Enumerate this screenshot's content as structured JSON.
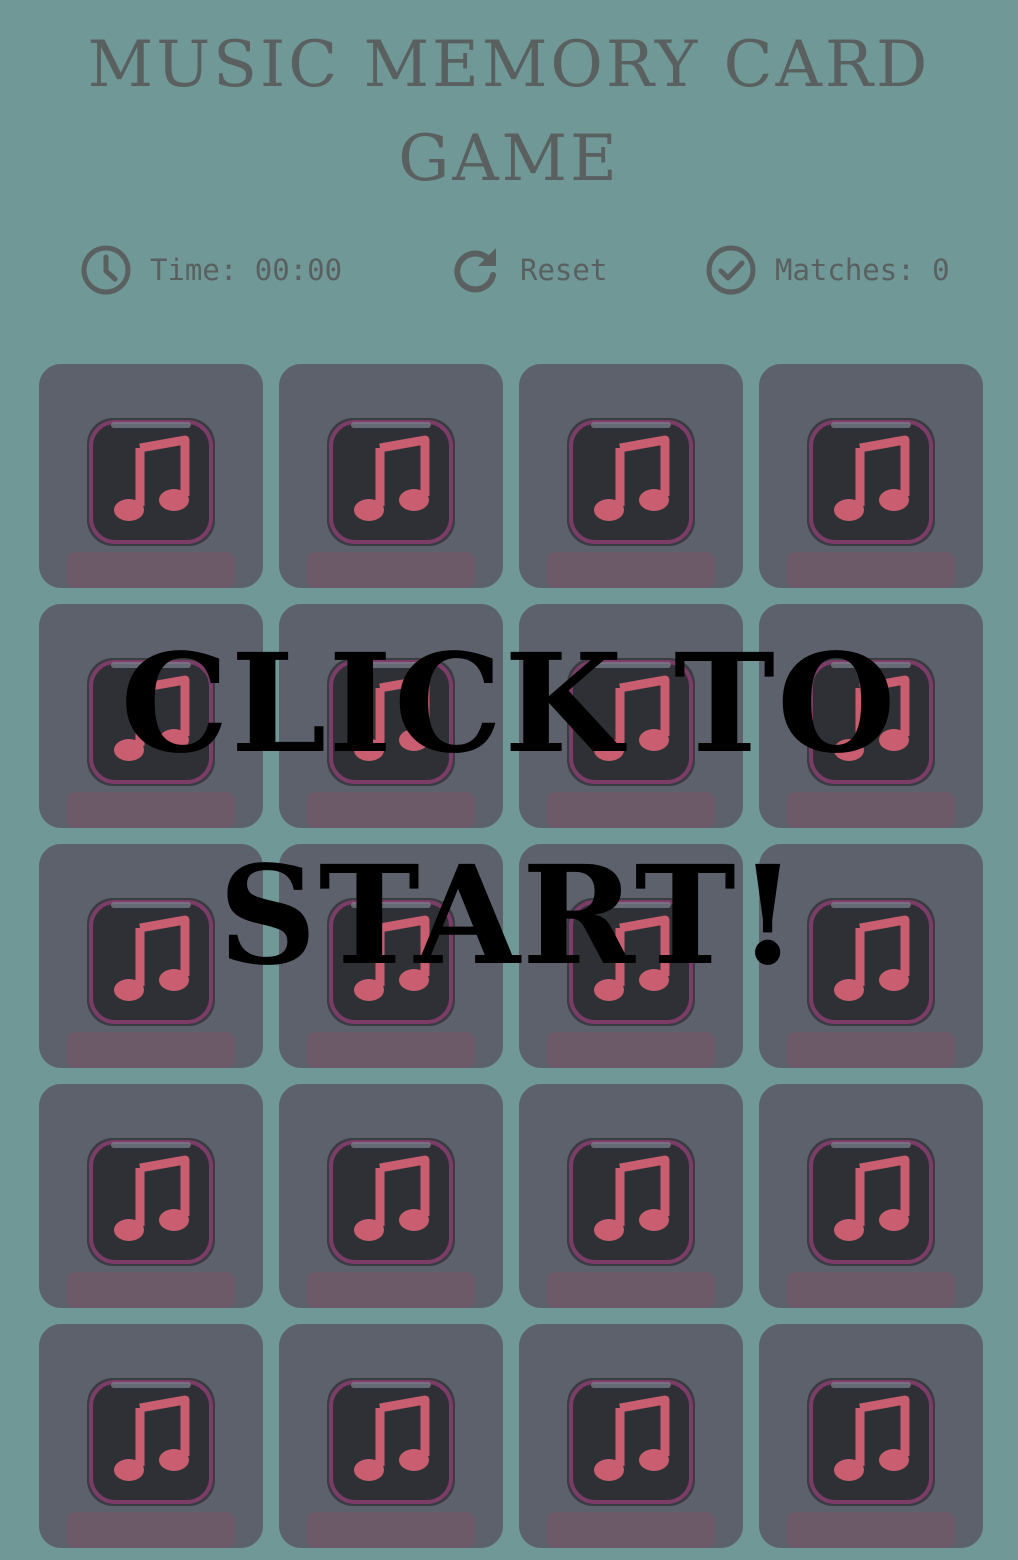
{
  "title": "MUSIC MEMORY CARD GAME",
  "status": {
    "time_label": "Time: 00:00",
    "reset_label": "Reset",
    "matches_label": "Matches: 0",
    "icons": {
      "time": "clock-icon",
      "reset": "reset-icon",
      "matches": "check-circle-icon"
    }
  },
  "board": {
    "rows": 5,
    "columns": 4,
    "card_face": "music-note-icon",
    "cards_face_down": 20
  },
  "overlay": {
    "text": "CLICK TO START!"
  },
  "colors": {
    "background": "#6f9896",
    "card_back": "#5c616b",
    "note_icon": "#c85e70",
    "text": "#5a605f",
    "overlay_text": "#000000"
  }
}
